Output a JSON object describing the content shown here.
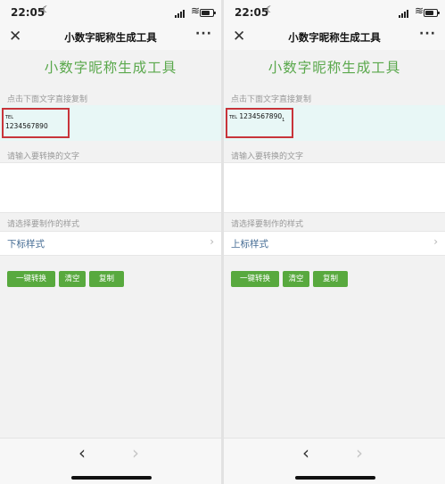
{
  "status": {
    "time": "22:05"
  },
  "nav": {
    "title": "小数字昵称生成工具"
  },
  "app": {
    "title": "小数字昵称生成工具",
    "copy_label": "点击下面文字直接复制",
    "input_label": "请输入要转换的文字",
    "style_label": "请选择要制作的样式",
    "buttons": {
      "convert": "一键转换",
      "clear": "清空",
      "copy": "复制"
    }
  },
  "panels": [
    {
      "style": "下标样式",
      "output_prefix": "TEL",
      "output_digits": "1234567890",
      "output_suffix": ""
    },
    {
      "style": "上标样式",
      "output_prefix": "TEL",
      "output_digits": "1234567890",
      "output_suffix": "1"
    }
  ],
  "colors": {
    "accent": "#5aa84c",
    "button": "#58a93e",
    "highlight": "#c8343a",
    "output_bg": "#e8f7f6"
  },
  "icons": [
    "moon-icon",
    "signal-icon",
    "wifi-icon",
    "battery-icon",
    "close-icon",
    "more-icon",
    "chevron-right-icon",
    "back-arrow-icon",
    "forward-arrow-icon"
  ]
}
